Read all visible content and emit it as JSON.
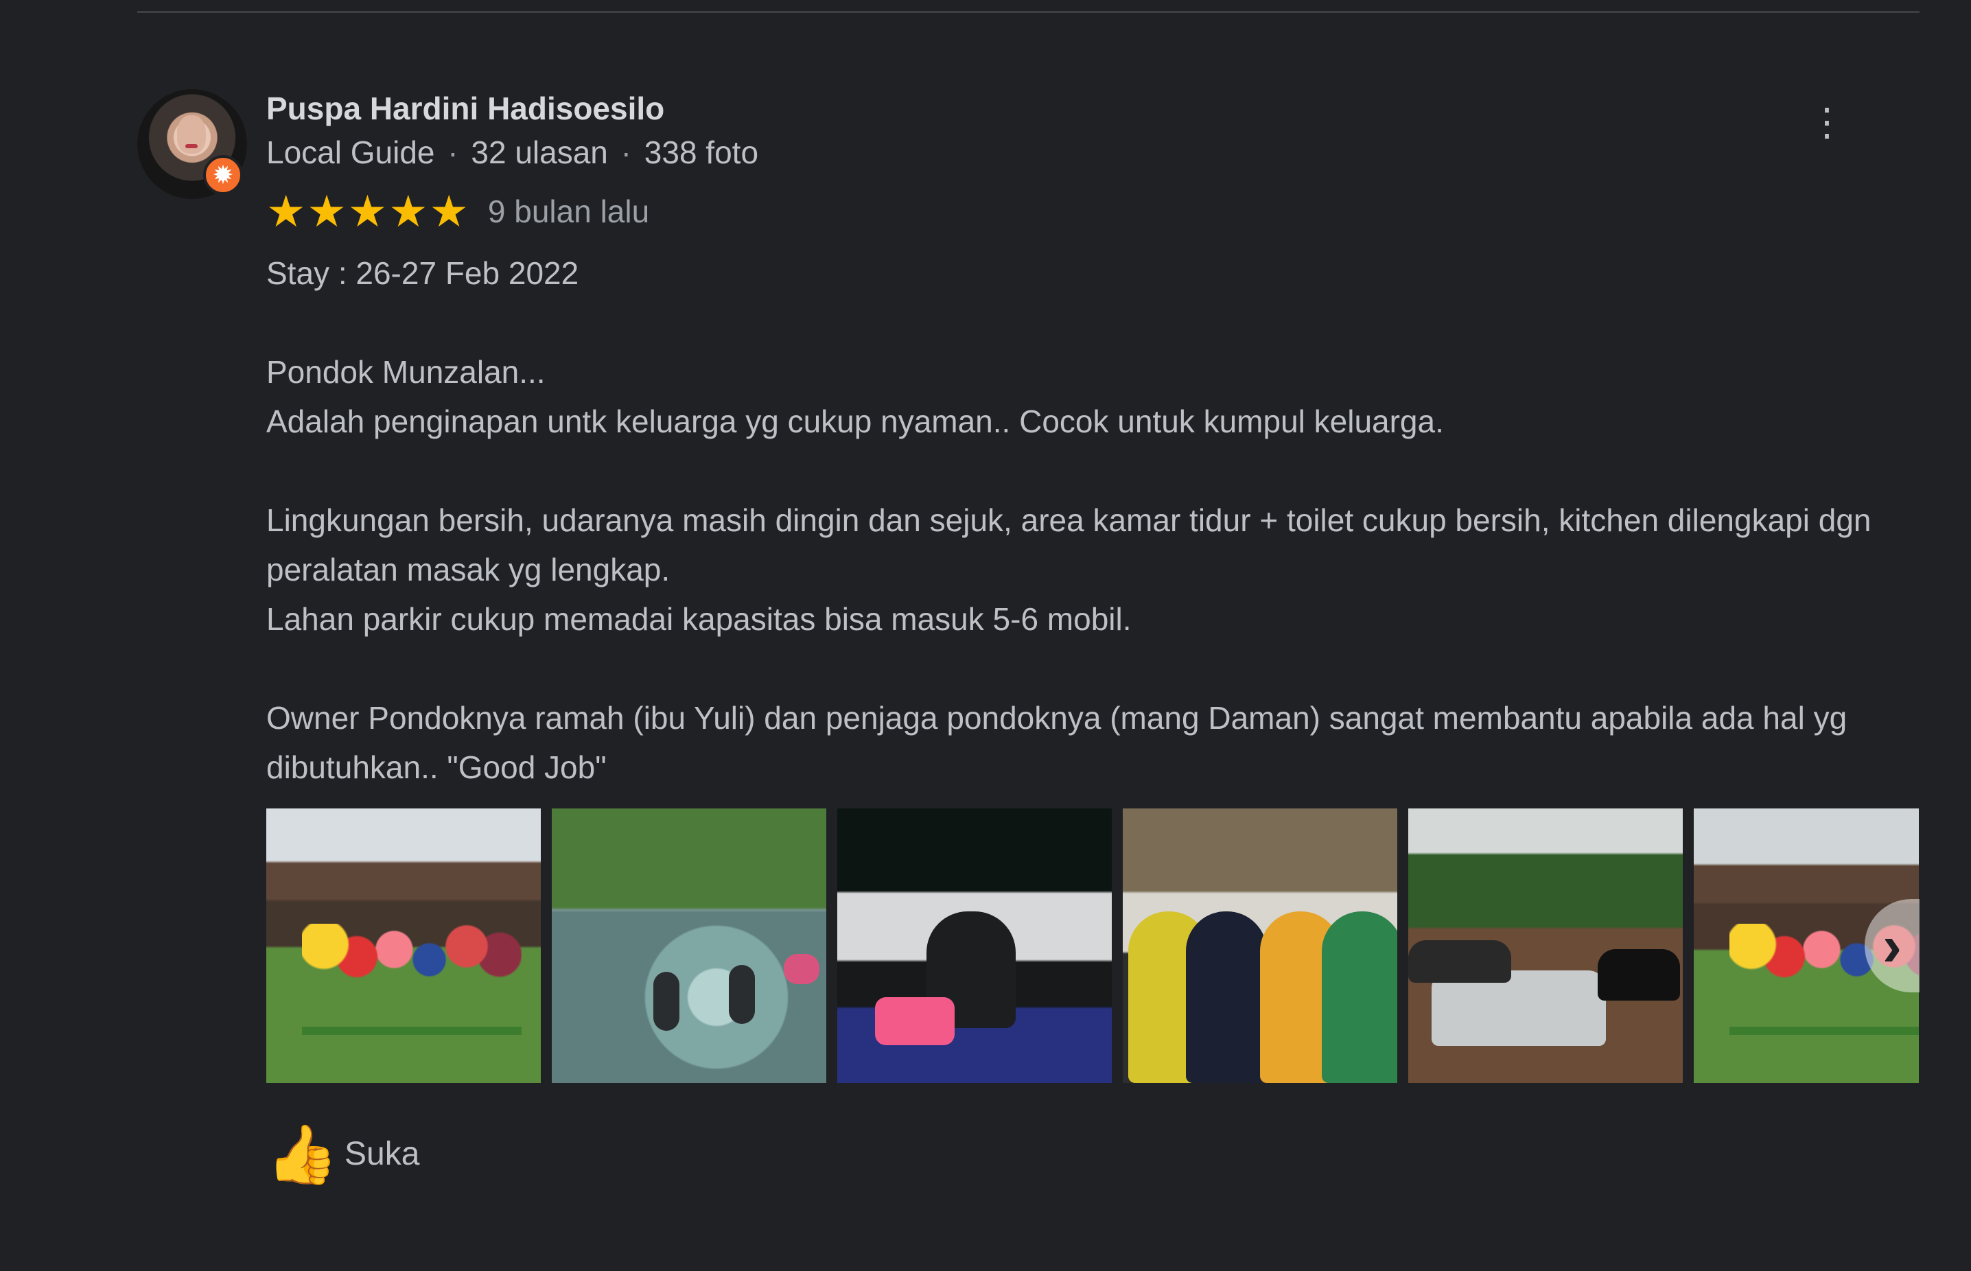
{
  "review": {
    "author": "Puspa Hardini Hadisoesilo",
    "badge": "Local Guide",
    "reviews_count": "32 ulasan",
    "photos_count": "338 foto",
    "separator": "·",
    "rating": 5,
    "stars": [
      "★",
      "★",
      "★",
      "★",
      "★"
    ],
    "time": "9 bulan lalu",
    "body": "Stay : 26-27 Feb 2022\n\nPondok Munzalan...\nAdalah penginapan untk keluarga yg cukup nyaman.. Cocok untuk kumpul keluarga.\n\nLingkungan bersih, udaranya masih dingin dan sejuk, area kamar tidur + toilet cukup bersih, kitchen dilengkapi dgn peralatan masak yg lengkap.\nLahan parkir cukup memadai kapasitas bisa masuk 5-6 mobil.\n\nOwner Pondoknya ramah (ibu Yuli) dan penjaga pondoknya (mang Daman) sangat membantu apabila ada hal yg dibutuhkan.. \"Good Job\"",
    "like_label": "Suka"
  },
  "icons": {
    "avatar": "avatar",
    "local_guide": "local-guide-star-icon",
    "more": "more-vert-icon",
    "thumb": "thumbs-up-icon",
    "next": "chevron-right-icon"
  },
  "colors": {
    "background": "#202124",
    "text": "#bdc1c6",
    "muted": "#9aa0a6",
    "star": "#fbbc04",
    "badge": "#f56e2c"
  }
}
